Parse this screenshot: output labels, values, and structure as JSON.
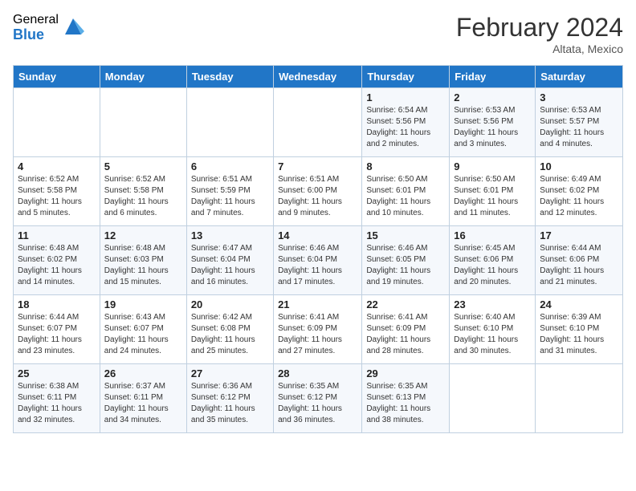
{
  "header": {
    "logo_general": "General",
    "logo_blue": "Blue",
    "title": "February 2024",
    "subtitle": "Altata, Mexico"
  },
  "days_of_week": [
    "Sunday",
    "Monday",
    "Tuesday",
    "Wednesday",
    "Thursday",
    "Friday",
    "Saturday"
  ],
  "weeks": [
    [
      {
        "day": "",
        "info": ""
      },
      {
        "day": "",
        "info": ""
      },
      {
        "day": "",
        "info": ""
      },
      {
        "day": "",
        "info": ""
      },
      {
        "day": "1",
        "info": "Sunrise: 6:54 AM\nSunset: 5:56 PM\nDaylight: 11 hours and 2 minutes."
      },
      {
        "day": "2",
        "info": "Sunrise: 6:53 AM\nSunset: 5:56 PM\nDaylight: 11 hours and 3 minutes."
      },
      {
        "day": "3",
        "info": "Sunrise: 6:53 AM\nSunset: 5:57 PM\nDaylight: 11 hours and 4 minutes."
      }
    ],
    [
      {
        "day": "4",
        "info": "Sunrise: 6:52 AM\nSunset: 5:58 PM\nDaylight: 11 hours and 5 minutes."
      },
      {
        "day": "5",
        "info": "Sunrise: 6:52 AM\nSunset: 5:58 PM\nDaylight: 11 hours and 6 minutes."
      },
      {
        "day": "6",
        "info": "Sunrise: 6:51 AM\nSunset: 5:59 PM\nDaylight: 11 hours and 7 minutes."
      },
      {
        "day": "7",
        "info": "Sunrise: 6:51 AM\nSunset: 6:00 PM\nDaylight: 11 hours and 9 minutes."
      },
      {
        "day": "8",
        "info": "Sunrise: 6:50 AM\nSunset: 6:01 PM\nDaylight: 11 hours and 10 minutes."
      },
      {
        "day": "9",
        "info": "Sunrise: 6:50 AM\nSunset: 6:01 PM\nDaylight: 11 hours and 11 minutes."
      },
      {
        "day": "10",
        "info": "Sunrise: 6:49 AM\nSunset: 6:02 PM\nDaylight: 11 hours and 12 minutes."
      }
    ],
    [
      {
        "day": "11",
        "info": "Sunrise: 6:48 AM\nSunset: 6:02 PM\nDaylight: 11 hours and 14 minutes."
      },
      {
        "day": "12",
        "info": "Sunrise: 6:48 AM\nSunset: 6:03 PM\nDaylight: 11 hours and 15 minutes."
      },
      {
        "day": "13",
        "info": "Sunrise: 6:47 AM\nSunset: 6:04 PM\nDaylight: 11 hours and 16 minutes."
      },
      {
        "day": "14",
        "info": "Sunrise: 6:46 AM\nSunset: 6:04 PM\nDaylight: 11 hours and 17 minutes."
      },
      {
        "day": "15",
        "info": "Sunrise: 6:46 AM\nSunset: 6:05 PM\nDaylight: 11 hours and 19 minutes."
      },
      {
        "day": "16",
        "info": "Sunrise: 6:45 AM\nSunset: 6:06 PM\nDaylight: 11 hours and 20 minutes."
      },
      {
        "day": "17",
        "info": "Sunrise: 6:44 AM\nSunset: 6:06 PM\nDaylight: 11 hours and 21 minutes."
      }
    ],
    [
      {
        "day": "18",
        "info": "Sunrise: 6:44 AM\nSunset: 6:07 PM\nDaylight: 11 hours and 23 minutes."
      },
      {
        "day": "19",
        "info": "Sunrise: 6:43 AM\nSunset: 6:07 PM\nDaylight: 11 hours and 24 minutes."
      },
      {
        "day": "20",
        "info": "Sunrise: 6:42 AM\nSunset: 6:08 PM\nDaylight: 11 hours and 25 minutes."
      },
      {
        "day": "21",
        "info": "Sunrise: 6:41 AM\nSunset: 6:09 PM\nDaylight: 11 hours and 27 minutes."
      },
      {
        "day": "22",
        "info": "Sunrise: 6:41 AM\nSunset: 6:09 PM\nDaylight: 11 hours and 28 minutes."
      },
      {
        "day": "23",
        "info": "Sunrise: 6:40 AM\nSunset: 6:10 PM\nDaylight: 11 hours and 30 minutes."
      },
      {
        "day": "24",
        "info": "Sunrise: 6:39 AM\nSunset: 6:10 PM\nDaylight: 11 hours and 31 minutes."
      }
    ],
    [
      {
        "day": "25",
        "info": "Sunrise: 6:38 AM\nSunset: 6:11 PM\nDaylight: 11 hours and 32 minutes."
      },
      {
        "day": "26",
        "info": "Sunrise: 6:37 AM\nSunset: 6:11 PM\nDaylight: 11 hours and 34 minutes."
      },
      {
        "day": "27",
        "info": "Sunrise: 6:36 AM\nSunset: 6:12 PM\nDaylight: 11 hours and 35 minutes."
      },
      {
        "day": "28",
        "info": "Sunrise: 6:35 AM\nSunset: 6:12 PM\nDaylight: 11 hours and 36 minutes."
      },
      {
        "day": "29",
        "info": "Sunrise: 6:35 AM\nSunset: 6:13 PM\nDaylight: 11 hours and 38 minutes."
      },
      {
        "day": "",
        "info": ""
      },
      {
        "day": "",
        "info": ""
      }
    ]
  ]
}
